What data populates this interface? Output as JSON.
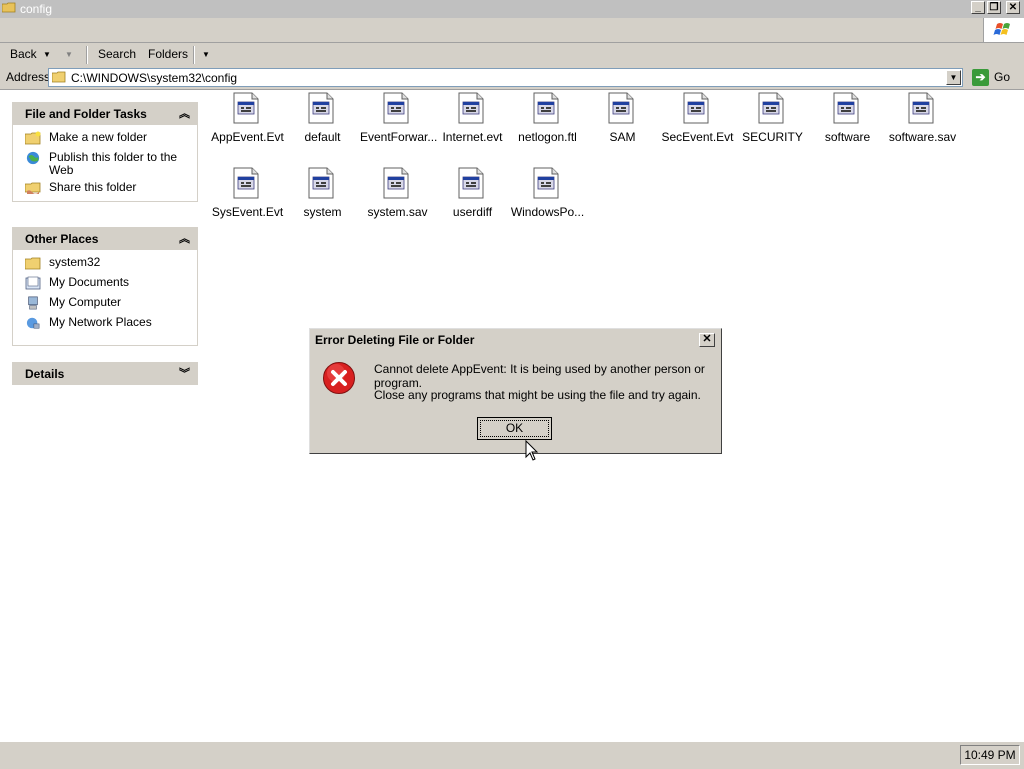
{
  "window": {
    "title": "config",
    "minimize_label": "_",
    "restore_label": "❐",
    "close_label": "✕"
  },
  "toolbar": {
    "back_label": "Back",
    "search_label": "Search",
    "folders_label": "Folders"
  },
  "address": {
    "label": "Address",
    "value": "C:\\WINDOWS\\system32\\config",
    "go_label": "Go"
  },
  "sidebar": {
    "tasks": {
      "title": "File and Folder Tasks",
      "items": [
        {
          "label": "Make a new folder",
          "icon": "new-folder-icon"
        },
        {
          "label": "Publish this folder to the Web",
          "icon": "globe-icon"
        },
        {
          "label": "Share this folder",
          "icon": "share-folder-icon"
        }
      ]
    },
    "places": {
      "title": "Other Places",
      "items": [
        {
          "label": "system32",
          "icon": "folder-icon"
        },
        {
          "label": "My Documents",
          "icon": "documents-icon"
        },
        {
          "label": "My Computer",
          "icon": "computer-icon"
        },
        {
          "label": "My Network Places",
          "icon": "network-icon"
        }
      ]
    },
    "details": {
      "title": "Details"
    }
  },
  "files": [
    "AppEvent.Evt",
    "default",
    "EventForwar...",
    "Internet.evt",
    "netlogon.ftl",
    "SAM",
    "SecEvent.Evt",
    "SECURITY",
    "software",
    "software.sav",
    "SysEvent.Evt",
    "system",
    "system.sav",
    "userdiff",
    "WindowsPo..."
  ],
  "dialog": {
    "title": "Error Deleting File or Folder",
    "message1": "Cannot delete AppEvent: It is being used by another person or program.",
    "message2": "Close any programs that might be using the file and try again.",
    "ok_label": "OK",
    "close_label": "✕",
    "icon": "error-icon"
  },
  "status": {
    "clock": "10:49 PM"
  }
}
